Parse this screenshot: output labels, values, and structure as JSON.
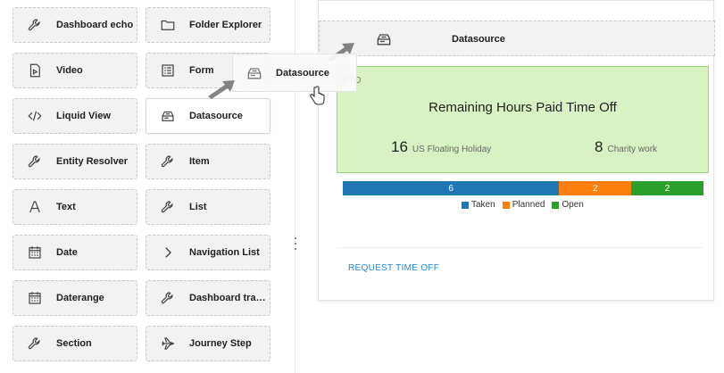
{
  "palette": {
    "items": [
      {
        "label": "Dashboard echo",
        "icon": "wrench-icon"
      },
      {
        "label": "Folder Explorer",
        "icon": "folder-icon"
      },
      {
        "label": "Video",
        "icon": "video-file-icon"
      },
      {
        "label": "Form",
        "icon": "form-icon"
      },
      {
        "label": "Liquid View",
        "icon": "code-icon"
      },
      {
        "label": "Datasource",
        "icon": "datasource-icon"
      },
      {
        "label": "Entity Resolver",
        "icon": "wrench-icon"
      },
      {
        "label": "Item",
        "icon": "wrench-icon"
      },
      {
        "label": "Text",
        "icon": "text-icon"
      },
      {
        "label": "List",
        "icon": "wrench-icon"
      },
      {
        "label": "Date",
        "icon": "calendar-icon"
      },
      {
        "label": "Navigation List",
        "icon": "chevron-right-icon"
      },
      {
        "label": "Daterange",
        "icon": "calendar-icon"
      },
      {
        "label": "Dashboard transf...",
        "icon": "wrench-icon"
      },
      {
        "label": "Section",
        "icon": "wrench-icon"
      },
      {
        "label": "Journey Step",
        "icon": "airplane-icon"
      }
    ]
  },
  "drag_ghost": {
    "label": "Datasource",
    "icon": "datasource-icon"
  },
  "canvas": {
    "datasource_header": {
      "label": "Datasource",
      "icon": "datasource-icon"
    },
    "pto": {
      "tag": "PTO",
      "title": "Remaining Hours Paid Time Off",
      "stats": [
        {
          "value": "16",
          "label": "US Floating Holiday"
        },
        {
          "value": "8",
          "label": "Charity work"
        }
      ]
    },
    "bar": {
      "segments": [
        {
          "name": "Taken",
          "value": 6,
          "color": "#1f77b4"
        },
        {
          "name": "Planned",
          "value": 2,
          "color": "#ff7f0e"
        },
        {
          "name": "Open",
          "value": 2,
          "color": "#2ca02c"
        }
      ]
    },
    "legend": [
      "Taken",
      "Planned",
      "Open"
    ],
    "request_link": "REQUEST TIME OFF"
  },
  "colors": {
    "pto_bg": "#d9f2c4",
    "pto_border": "#9ed67d",
    "link": "#1e88d6"
  }
}
